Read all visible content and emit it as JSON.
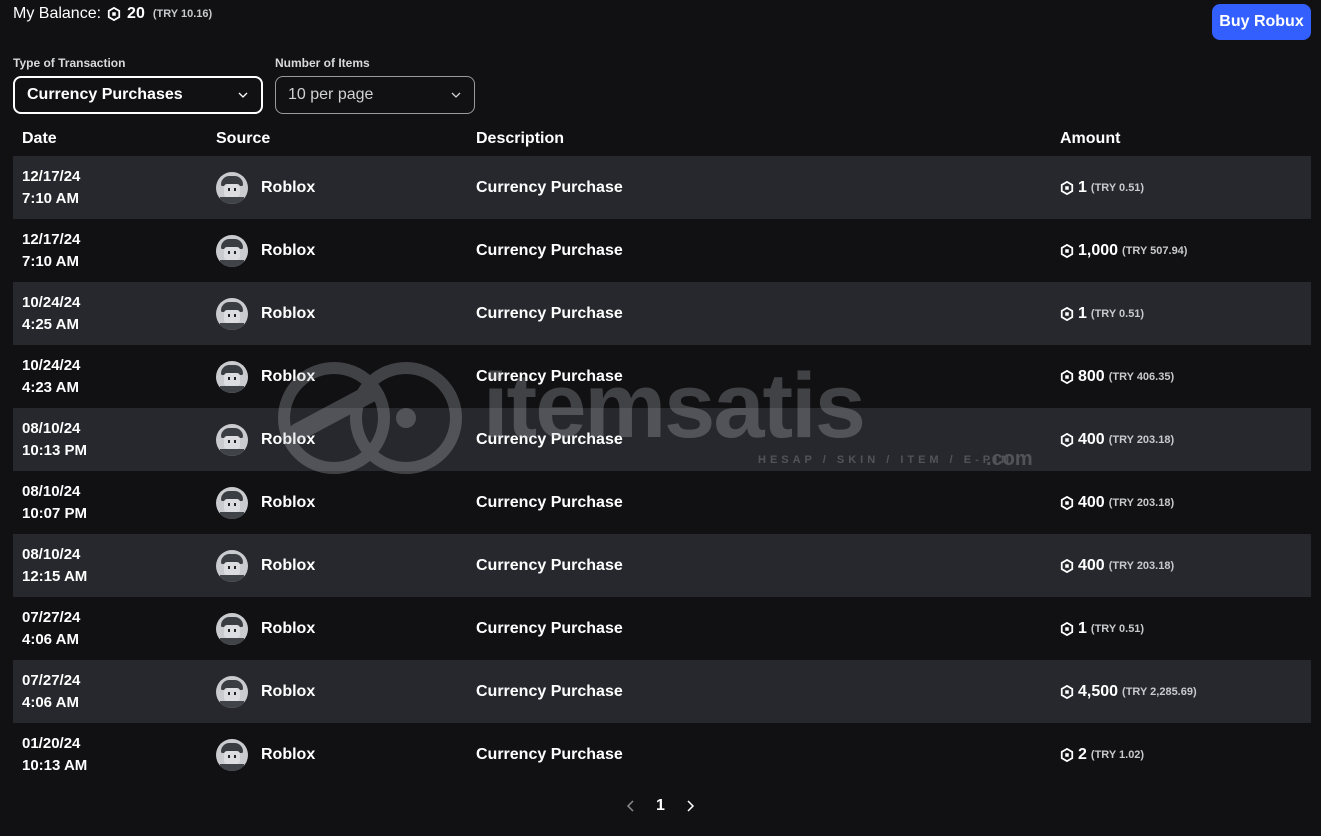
{
  "header": {
    "balance_label": "My Balance:",
    "balance_amount": "20",
    "balance_try": "(TRY 10.16)",
    "buy_button": "Buy Robux"
  },
  "filters": {
    "type_label": "Type of Transaction",
    "type_value": "Currency Purchases",
    "count_label": "Number of Items",
    "count_value": "10 per page"
  },
  "table": {
    "headers": {
      "date": "Date",
      "source": "Source",
      "description": "Description",
      "amount": "Amount"
    },
    "rows": [
      {
        "date": "12/17/24",
        "time": "7:10 AM",
        "source": "Roblox",
        "description": "Currency Purchase",
        "amount": "1",
        "try": "(TRY 0.51)"
      },
      {
        "date": "12/17/24",
        "time": "7:10 AM",
        "source": "Roblox",
        "description": "Currency Purchase",
        "amount": "1,000",
        "try": "(TRY 507.94)"
      },
      {
        "date": "10/24/24",
        "time": "4:25 AM",
        "source": "Roblox",
        "description": "Currency Purchase",
        "amount": "1",
        "try": "(TRY 0.51)"
      },
      {
        "date": "10/24/24",
        "time": "4:23 AM",
        "source": "Roblox",
        "description": "Currency Purchase",
        "amount": "800",
        "try": "(TRY 406.35)"
      },
      {
        "date": "08/10/24",
        "time": "10:13 PM",
        "source": "Roblox",
        "description": "Currency Purchase",
        "amount": "400",
        "try": "(TRY 203.18)"
      },
      {
        "date": "08/10/24",
        "time": "10:07 PM",
        "source": "Roblox",
        "description": "Currency Purchase",
        "amount": "400",
        "try": "(TRY 203.18)"
      },
      {
        "date": "08/10/24",
        "time": "12:15 AM",
        "source": "Roblox",
        "description": "Currency Purchase",
        "amount": "400",
        "try": "(TRY 203.18)"
      },
      {
        "date": "07/27/24",
        "time": "4:06 AM",
        "source": "Roblox",
        "description": "Currency Purchase",
        "amount": "1",
        "try": "(TRY 0.51)"
      },
      {
        "date": "07/27/24",
        "time": "4:06 AM",
        "source": "Roblox",
        "description": "Currency Purchase",
        "amount": "4,500",
        "try": "(TRY 2,285.69)"
      },
      {
        "date": "01/20/24",
        "time": "10:13 AM",
        "source": "Roblox",
        "description": "Currency Purchase",
        "amount": "2",
        "try": "(TRY 1.02)"
      }
    ]
  },
  "pagination": {
    "current_page": "1",
    "prev_icon": "chevron-left-icon",
    "next_icon": "chevron-right-icon"
  },
  "watermark": {
    "brand": "itemsatis",
    "tagline": "HESAP / SKIN / ITEM / E-PIN",
    "suffix": ".com"
  },
  "colors": {
    "background": "#111114",
    "row_shade": "#26282d",
    "accent": "#335fff",
    "text": "#ffffff"
  },
  "icons": {
    "robux": "robux-icon",
    "dropdown": "chevron-down-icon",
    "avatar": "avatar"
  }
}
